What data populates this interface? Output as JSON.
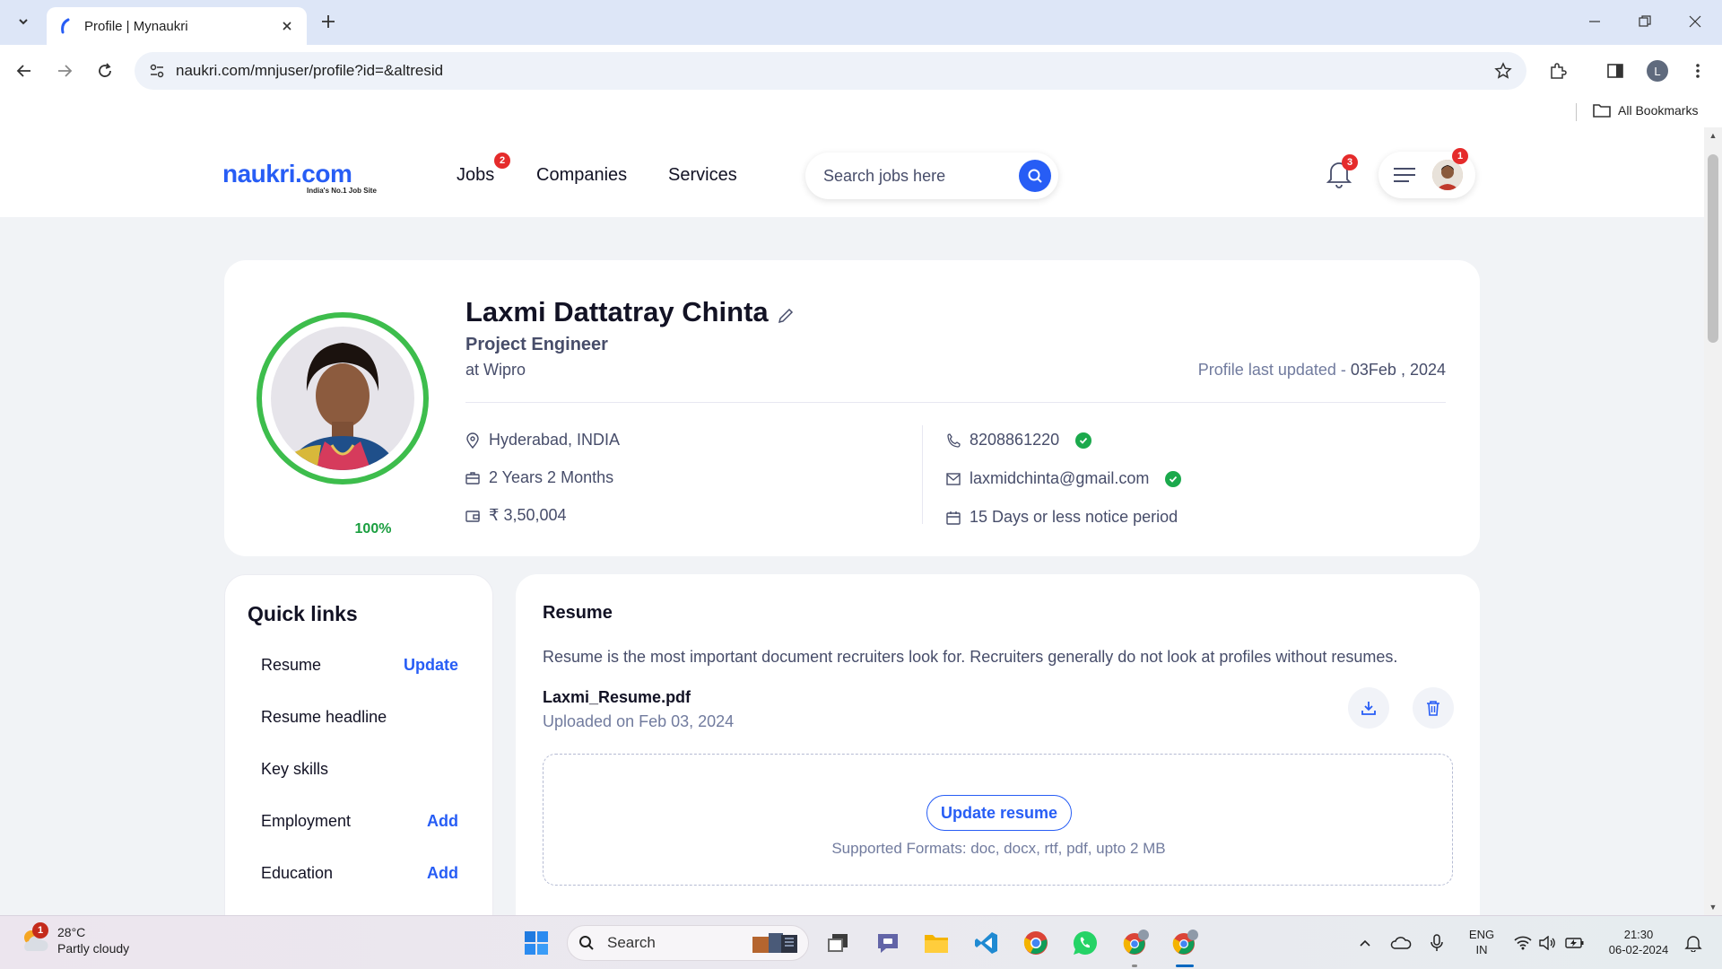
{
  "browser": {
    "tab_title": "Profile | Mynaukri",
    "url": "naukri.com/mnjuser/profile?id=&altresid",
    "profile_initial": "L",
    "bookmarks_label": "All Bookmarks"
  },
  "header": {
    "logo_text": "naukri.com",
    "logo_tagline": "India's No.1 Job Site",
    "nav": [
      {
        "label": "Jobs",
        "badge": "2"
      },
      {
        "label": "Companies"
      },
      {
        "label": "Services"
      }
    ],
    "search_placeholder": "Search jobs here",
    "notification_count": "3",
    "menu_badge": "1"
  },
  "profile": {
    "name": "Laxmi Dattatray Chinta",
    "title": "Project Engineer",
    "company": "at Wipro",
    "updated_label": "Profile last updated -",
    "updated_date": "03Feb , 2024",
    "completion": "100%",
    "location": "Hyderabad, INDIA",
    "experience": "2 Years 2 Months",
    "salary": "₹ 3,50,004",
    "phone": "8208861220",
    "email": "laxmidchinta@gmail.com",
    "notice": "15 Days or less notice period"
  },
  "quick_links": {
    "title": "Quick links",
    "items": [
      {
        "label": "Resume",
        "action": "Update"
      },
      {
        "label": "Resume headline",
        "action": ""
      },
      {
        "label": "Key skills",
        "action": ""
      },
      {
        "label": "Employment",
        "action": "Add"
      },
      {
        "label": "Education",
        "action": "Add"
      }
    ]
  },
  "resume": {
    "title": "Resume",
    "description": "Resume is the most important document recruiters look for. Recruiters generally do not look at profiles without resumes.",
    "file_name": "Laxmi_Resume.pdf",
    "uploaded": "Uploaded on Feb 03, 2024",
    "update_button": "Update resume",
    "formats": "Supported Formats: doc, docx, rtf, pdf, upto 2 MB"
  },
  "taskbar": {
    "weather_alert": "1",
    "temperature": "28°C",
    "weather_desc": "Partly cloudy",
    "search_label": "Search",
    "lang_top": "ENG",
    "lang_bottom": "IN",
    "time": "21:30",
    "date": "06-02-2024"
  },
  "colors": {
    "brand": "#275df5",
    "verified": "#1ba94c",
    "badge": "#e52b2b",
    "completion_ring": "#3dbd4c"
  }
}
